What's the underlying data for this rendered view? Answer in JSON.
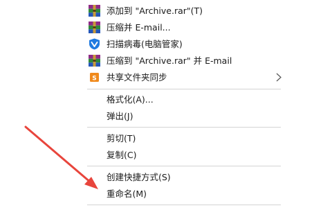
{
  "menu": {
    "items": [
      {
        "label": "添加到 \"Archive.rar\"(T)",
        "icon": "winrar-icon"
      },
      {
        "label": "压缩并 E-mail...",
        "icon": "winrar-icon"
      },
      {
        "label": "扫描病毒(电脑管家)",
        "icon": "tencent-pc-manager-shield-icon"
      },
      {
        "label": "压缩到 \"Archive.rar\" 并 E-mail",
        "icon": "winrar-icon"
      },
      {
        "label": "共享文件夹同步",
        "icon": "sync-folder-icon",
        "submenu": true
      },
      {
        "label": "格式化(A)..."
      },
      {
        "label": "弹出(J)"
      },
      {
        "label": "剪切(T)"
      },
      {
        "label": "复制(C)"
      },
      {
        "label": "创建快捷方式(S)"
      },
      {
        "label": "重命名(M)"
      }
    ]
  },
  "colors": {
    "annotation_arrow": "#e8453c",
    "text": "#1a1a1a",
    "separator": "#d4d4d4",
    "shield_blue": "#1f7ae0",
    "sync_orange": "#f08a1c"
  }
}
